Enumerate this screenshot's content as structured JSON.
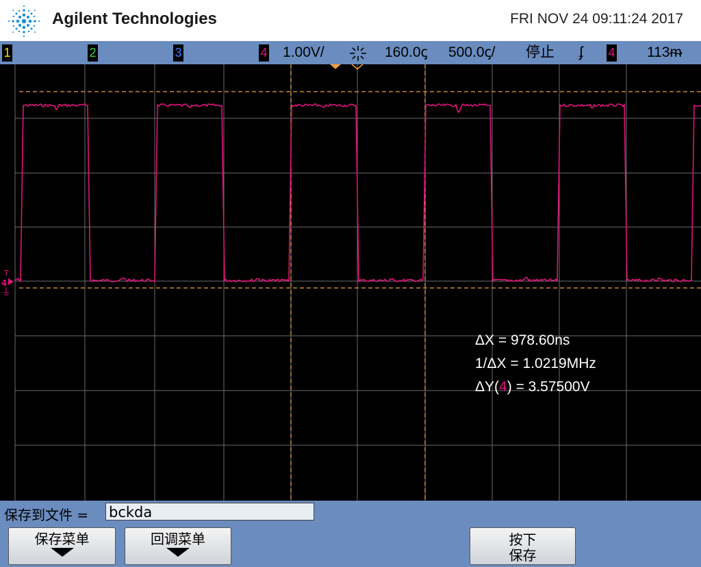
{
  "header": {
    "brand": "Agilent Technologies",
    "datetime": "FRI NOV 24 09:11:24 2017"
  },
  "status": {
    "channels": [
      {
        "label": "1",
        "color": "#f2e600"
      },
      {
        "label": "2",
        "color": "#37d63a"
      },
      {
        "label": "3",
        "color": "#4d7cff"
      },
      {
        "label": "4",
        "color": "#e0147a"
      }
    ],
    "volts_per_div": "1.00V/",
    "time_position": "160.0ꞔ",
    "time_per_div": "500.0ꞔ/",
    "run_state": "停止",
    "trigger_slope": "ʄ",
    "trigger_channel": "4",
    "trigger_level": "113ᵯ"
  },
  "scope": {
    "trace_color": "#e0147a",
    "cursor_color": "#f0a040",
    "marker_labels": [
      "T",
      "4"
    ],
    "waveform": {
      "edges_x": [
        32,
        130,
        228,
        326,
        424,
        522,
        620,
        718,
        816,
        914,
        1012
      ],
      "high_first": true
    }
  },
  "measurements": {
    "dx_label": "ΔX",
    "dx_value": "= 978.60ns",
    "inv_dx_label": "1/ΔX",
    "inv_dx_value": "= 1.0219MHz",
    "dy_label_pre": "ΔY(",
    "dy_channel": "4",
    "dy_label_post": ")",
    "dy_value": "= 3.57500V"
  },
  "save": {
    "label": "保存到文件 =",
    "filename": "bckda"
  },
  "softkeys": {
    "save_menu": "保存菜单",
    "recall_menu": "回调菜单",
    "press_line1": "按下",
    "press_line2": "保存"
  }
}
